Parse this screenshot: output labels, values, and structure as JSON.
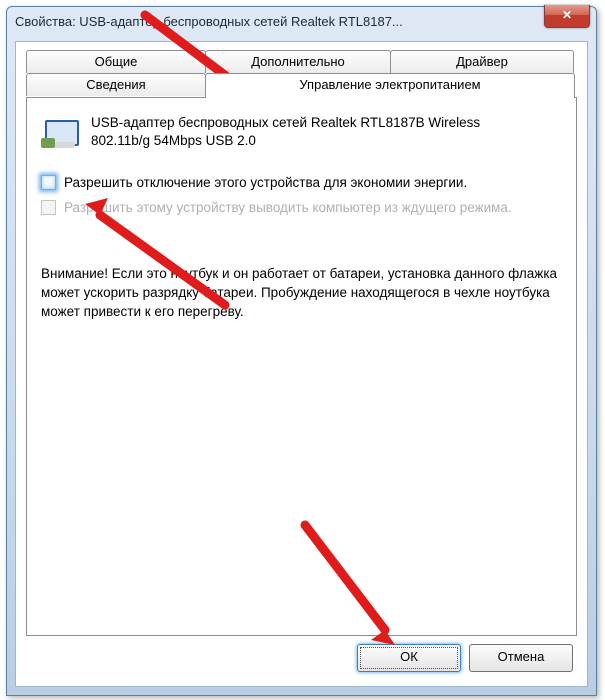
{
  "window": {
    "title": "Свойства: USB-адаптер беспроводных сетей Realtek RTL8187..."
  },
  "tabs": {
    "general": "Общие",
    "advanced": "Дополнительно",
    "driver": "Драйвер",
    "details": "Сведения",
    "power": "Управление электропитанием"
  },
  "device": {
    "name_line1": "USB-адаптер беспроводных сетей Realtek RTL8187B Wireless",
    "name_line2": "802.11b/g 54Mbps USB 2.0"
  },
  "checkboxes": {
    "allow_off": "Разрешить отключение этого устройства для экономии энергии.",
    "allow_wake": "Разрешить этому устройству выводить компьютер из ждущего режима."
  },
  "warning_text": "Внимание! Если это ноутбук и он работает от батареи, установка данного флажка может ускорить разрядку батареи. Пробуждение находящегося в чехле ноутбука может привести к его перегреву.",
  "buttons": {
    "ok": "ОК",
    "cancel": "Отмена"
  }
}
